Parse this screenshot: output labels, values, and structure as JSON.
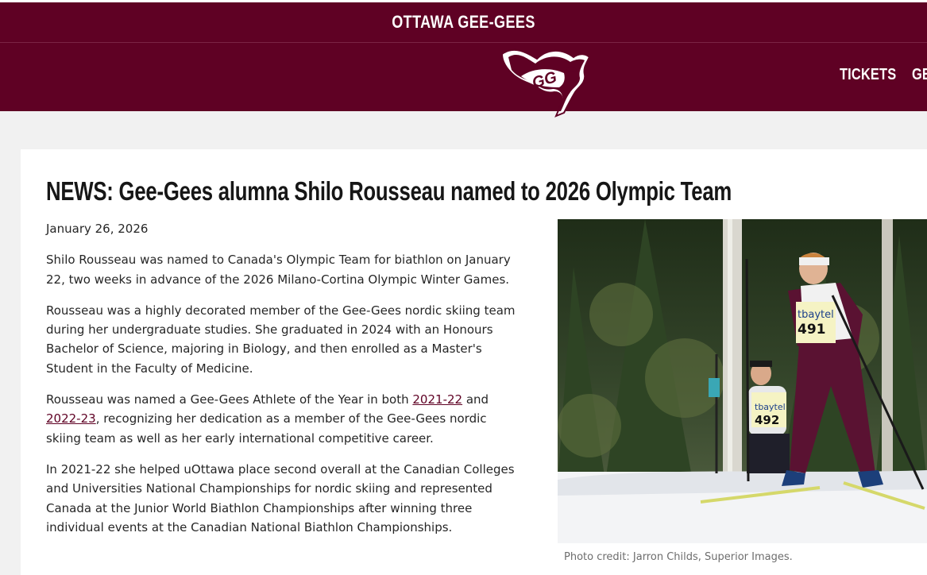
{
  "header": {
    "site_title": "OTTAWA GEE-GEES",
    "nav": [
      {
        "label": "TICKETS"
      },
      {
        "label": "GE"
      }
    ],
    "logo_text": "GG"
  },
  "article": {
    "headline": "NEWS: Gee-Gees alumna Shilo Rousseau named to 2026 Olympic Team",
    "date": "January 26, 2026",
    "p1": "Shilo Rousseau was named to Canada's Olympic Team for biathlon on January 22, two weeks in advance of the 2026 Milano-Cortina Olympic Winter Games.",
    "p2": "Rousseau was a highly decorated member of the Gee-Gees nordic skiing team during her undergraduate studies. She graduated in 2024 with an Honours Bachelor of Science, majoring in Biology, and then enrolled as a Master's Student in the Faculty of Medicine.",
    "p3": {
      "before": "Rousseau was named a Gee-Gees Athlete of the Year in both ",
      "link1": "2021-22",
      "middle": " and ",
      "link2": "2022-23",
      "after": ", recognizing her dedication as a member of the Gee-Gees nordic skiing team as well as her early international competitive career."
    },
    "p4": "In 2021-22 she helped uOttawa place second overall at the Canadian Colleges and Universities National Championships for nordic skiing and represented Canada at the Junior World Biathlon Championships after winning three individual events at the Canadian National Biathlon Championships.",
    "photo": {
      "sponsor": "tbaytel",
      "bib_front": "491",
      "bib_back": "492",
      "caption": "Photo credit: Jarron Childs, Superior Images."
    }
  },
  "colors": {
    "brand": "#5f0124",
    "text": "#262626",
    "background": "#f1f1f1"
  }
}
